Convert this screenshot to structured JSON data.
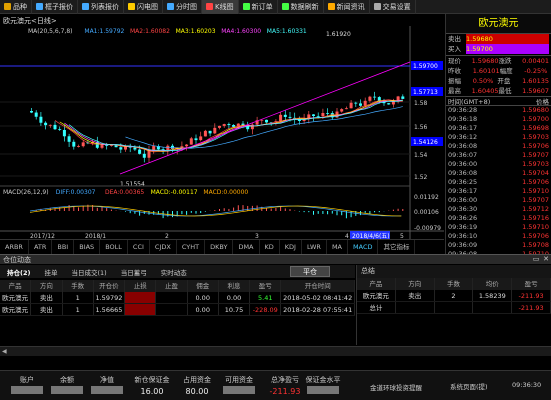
{
  "toolbar": [
    {
      "label": "品种",
      "icon": "list-icon",
      "color": "#e0a000"
    },
    {
      "label": "框子报价",
      "icon": "grid-icon",
      "color": "#4af"
    },
    {
      "label": "列表报价",
      "icon": "table-icon",
      "color": "#4af"
    },
    {
      "label": "闪电图",
      "icon": "flash-icon",
      "color": "#fc0"
    },
    {
      "label": "分时图",
      "icon": "timeline-icon",
      "color": "#4af"
    },
    {
      "label": "K线图",
      "icon": "kline-icon",
      "color": "#f44",
      "active": true
    },
    {
      "label": "新订单",
      "icon": "new-order-icon",
      "color": "#4f4"
    },
    {
      "label": "数据刷新",
      "icon": "refresh-icon",
      "color": "#4f4"
    },
    {
      "label": "新闻资讯",
      "icon": "news-icon",
      "color": "#fa0"
    },
    {
      "label": "交易设置",
      "icon": "settings-icon",
      "color": "#aaa"
    }
  ],
  "chart": {
    "title": "欧元澳元<日线>",
    "ma_labels": [
      {
        "text": "MA(20,5,6,7,8)",
        "color": "#ccc"
      },
      {
        "text": "MA1:1.59792",
        "color": "#4af"
      },
      {
        "text": "MA2:1.60082",
        "color": "#f44"
      },
      {
        "text": "MA3:1.60203",
        "color": "#ff0"
      },
      {
        "text": "MA4:1.60300",
        "color": "#f4f"
      },
      {
        "text": "MA5:1.60331",
        "color": "#4ff"
      }
    ],
    "price_axis": [
      "1.6",
      "1.58",
      "1.56",
      "1.54",
      "1.52"
    ],
    "high_label": "1.61920",
    "low_label": "1.51554",
    "price_tags": [
      {
        "text": "1.59700",
        "color": "#00f"
      },
      {
        "text": "1.57713",
        "color": "#00f"
      },
      {
        "text": "1.54126",
        "color": "#00f"
      }
    ],
    "macd_labels": [
      {
        "text": "MACD(26,12,9)",
        "color": "#ccc"
      },
      {
        "text": "DIFF:0.00307",
        "color": "#4af"
      },
      {
        "text": "DEA:0.00365",
        "color": "#f44"
      },
      {
        "text": "MACD:-0.00117",
        "color": "#ff0"
      },
      {
        "text": "MACD:0.00000",
        "color": "#fa0"
      }
    ],
    "macd_axis": [
      "0.01192",
      "0.00106",
      "-0.00979"
    ],
    "date_axis": [
      "2017/12",
      "2018/1",
      "2",
      "3",
      "4",
      "5"
    ],
    "cursor_date": "2018/4/6(五)"
  },
  "indicator_tabs": [
    "ARBR",
    "ATR",
    "BBI",
    "BIAS",
    "BOLL",
    "CCI",
    "CJDX",
    "CYHT",
    "DKBY",
    "DMA",
    "KD",
    "KDJ",
    "LWR",
    "MA",
    "MACD",
    "其它指标"
  ],
  "indicator_active": "MACD",
  "right_panel": {
    "title": "欧元澳元",
    "sell_label": "卖出",
    "sell": "1.59680",
    "buy_label": "买入",
    "buy": "1.59700",
    "rows": [
      {
        "l1": "现价",
        "v1": "1.59680",
        "l2": "涨跌",
        "v2": "0.00401"
      },
      {
        "l1": "昨收",
        "v1": "1.60101",
        "l2": "幅度",
        "v2": "-0.25%"
      },
      {
        "l1": "振幅",
        "v1": "0.50%",
        "l2": "开盘",
        "v2": "1.60135"
      },
      {
        "l1": "最高",
        "v1": "1.60405",
        "l2": "最低",
        "v2": "1.59607"
      }
    ],
    "time_header": "时间(GMT+8)",
    "price_header": "价格",
    "ticks": [
      [
        "09:36:28",
        "1.59680"
      ],
      [
        "09:36:18",
        "1.59700"
      ],
      [
        "09:36:17",
        "1.59698"
      ],
      [
        "09:36:12",
        "1.59703"
      ],
      [
        "09:36:08",
        "1.59706"
      ],
      [
        "09:36:07",
        "1.59707"
      ],
      [
        "09:36:00",
        "1.59703"
      ],
      [
        "09:36:08",
        "1.59704"
      ],
      [
        "09:36:25",
        "1.59706"
      ],
      [
        "09:36:17",
        "1.59710"
      ],
      [
        "09:36:00",
        "1.59707"
      ],
      [
        "09:36:30",
        "1.59712"
      ],
      [
        "09:36:26",
        "1.59716"
      ],
      [
        "09:36:19",
        "1.59710"
      ],
      [
        "09:36:10",
        "1.59706"
      ],
      [
        "09:36:09",
        "1.59708"
      ],
      [
        "09:36:08",
        "1.59710"
      ]
    ]
  },
  "position": {
    "header": "仓位动态",
    "tabs": [
      "持仓(2)",
      "挂单",
      "当日成交(1)",
      "当日蓄弓",
      "实时动态"
    ],
    "close_btn": "平仓",
    "columns": [
      "产品",
      "方向",
      "手数",
      "开仓价",
      "止损",
      "止盈",
      "佣金",
      "利息",
      "盈亏",
      "开仓时间"
    ],
    "rows": [
      [
        "欧元澳元",
        "卖出",
        "1",
        "1.59792",
        "",
        "",
        "0.00",
        "0.00",
        "5.41",
        "2018-05-02 08:41:42"
      ],
      [
        "欧元澳元",
        "卖出",
        "1",
        "1.56665",
        "",
        "",
        "0.00",
        "10.75",
        "-228.09",
        "2018-02-28 07:55:41"
      ]
    ]
  },
  "summary": {
    "title": "总结",
    "columns": [
      "产品",
      "方向",
      "手数",
      "均价",
      "盈亏"
    ],
    "rows": [
      [
        "欧元澳元",
        "卖出",
        "2",
        "1.58239",
        "-211.93"
      ],
      [
        "总计",
        "",
        "",
        "",
        "-211.93"
      ]
    ]
  },
  "status": {
    "cols": [
      {
        "label": "账户",
        "value": ""
      },
      {
        "label": "余额",
        "value": ""
      },
      {
        "label": "净值",
        "value": ""
      },
      {
        "label": "新仓保证金",
        "value": "16.00"
      },
      {
        "label": "占用资金",
        "value": "80.00"
      },
      {
        "label": "可用资金",
        "value": ""
      },
      {
        "label": "总净盈亏",
        "value": "-211.93"
      },
      {
        "label": "保证金水平",
        "value": ""
      }
    ],
    "news": "金道环球投资提醒",
    "system": "系统页面(提)",
    "time": "09:36:30"
  }
}
